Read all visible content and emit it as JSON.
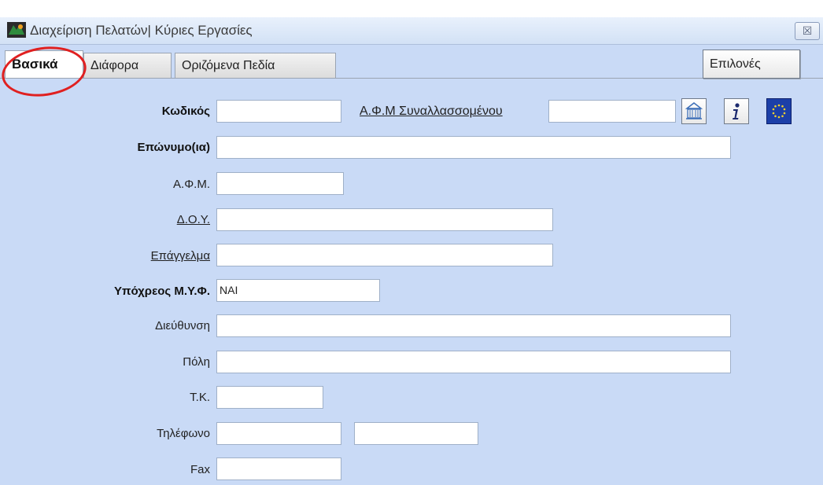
{
  "window": {
    "title": "Διαχείριση Πελατών| Κύριες Εργασίες",
    "close_symbol": "☒",
    "app_icon": "app-logo-icon"
  },
  "tabs": [
    {
      "label": "Βασικά",
      "active": true
    },
    {
      "label": "Διάφορα",
      "active": false
    },
    {
      "label": "Οριζόμενα Πεδία",
      "active": false
    }
  ],
  "options_button": "Επιλονές",
  "fields": {
    "code": {
      "label": "Κωδικός",
      "value": ""
    },
    "counterparty_afm": {
      "label": "Α.Φ.Μ Συναλλασσομένου",
      "value": ""
    },
    "surname": {
      "label": "Επώνυμο(ια)",
      "value": ""
    },
    "afm": {
      "label": "Α.Φ.Μ.",
      "value": ""
    },
    "doy": {
      "label": "Δ.Ο.Υ.",
      "value": ""
    },
    "profession": {
      "label": "Επάγγελμα",
      "value": ""
    },
    "myf": {
      "label": "Υπόχρεος Μ.Υ.Φ.",
      "value": "ΝΑΙ"
    },
    "address": {
      "label": "Διεύθυνση",
      "value": ""
    },
    "city": {
      "label": "Πόλη",
      "value": ""
    },
    "postcode": {
      "label": "Τ.Κ.",
      "value": ""
    },
    "phone": {
      "label": "Τηλέφωνο",
      "value": "",
      "value2": ""
    },
    "fax": {
      "label": "Fax",
      "value": ""
    }
  },
  "toolbar_icons": [
    "taxis-building-icon",
    "info-icon",
    "eu-flag-icon"
  ],
  "colors": {
    "background": "#c9daf6",
    "highlight_circle": "#e02020",
    "eu_blue": "#1c3fa8",
    "eu_star": "#f2d22e",
    "info": "#1c2a6e"
  }
}
